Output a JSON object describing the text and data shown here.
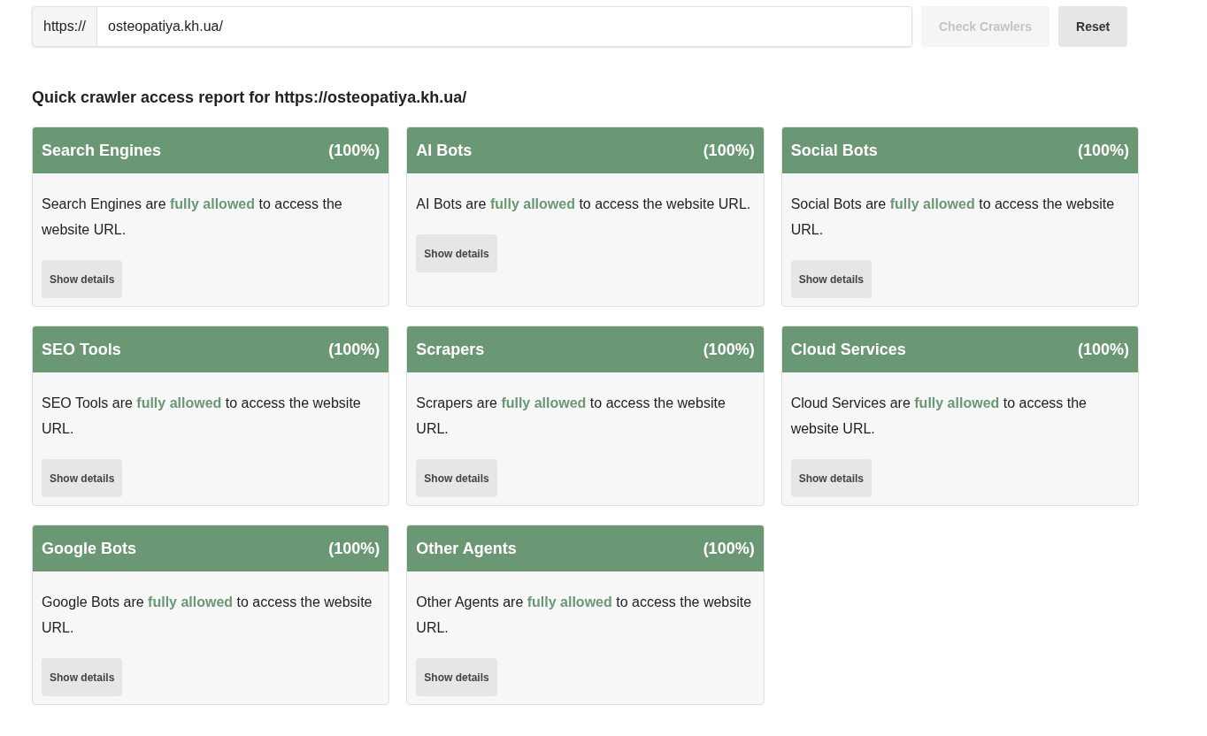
{
  "url_form": {
    "prefix": "https://",
    "value": "osteopatiya.kh.ua/",
    "buttons": [
      {
        "label": "Check Crawlers",
        "disabled": true
      },
      {
        "label": "Reset",
        "disabled": false
      }
    ]
  },
  "report": {
    "heading": "Quick crawler access report for https://osteopatiya.kh.ua/",
    "cards": [
      {
        "title": "Search Engines",
        "percent": "(100%)",
        "text": "Search Engines are **fully allowed** to access the website URL.",
        "button": "Show details"
      },
      {
        "title": "AI Bots",
        "percent": "(100%)",
        "text": "AI Bots are **fully allowed** to access the website URL.",
        "button": "Show details"
      },
      {
        "title": "Social Bots",
        "percent": "(100%)",
        "text": "Social Bots are **fully allowed** to access the website URL.",
        "button": "Show details"
      },
      {
        "title": "SEO Tools",
        "percent": "(100%)",
        "text": "SEO Tools are **fully allowed** to access the website URL.",
        "button": "Show details"
      },
      {
        "title": "Scrapers",
        "percent": "(100%)",
        "text": "Scrapers are **fully allowed** to access the website URL.",
        "button": "Show details"
      },
      {
        "title": "Cloud Services",
        "percent": "(100%)",
        "text": "Cloud Services are **fully allowed** to access the website URL.",
        "button": "Show details"
      },
      {
        "title": "Google Bots",
        "percent": "(100%)",
        "text": "Google Bots are **fully allowed** to access the website URL.",
        "button": "Show details"
      },
      {
        "title": "Other Agents",
        "percent": "(100%)",
        "text": "Other Agents are **fully allowed** to access the website URL.",
        "button": "Show details"
      }
    ]
  }
}
